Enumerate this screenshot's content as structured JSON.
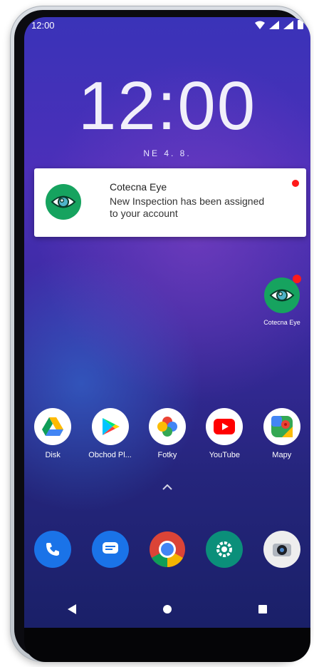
{
  "status_bar": {
    "time": "12:00"
  },
  "lockscreen": {
    "clock": "12:00",
    "date": "NE 4. 8."
  },
  "notification": {
    "app_name": "Cotecna Eye",
    "message_line1": "New Inspection has been assigned",
    "message_line2": "to your account"
  },
  "desktop_app": {
    "label": "Cotecna Eye"
  },
  "apps": [
    {
      "label": "Disk"
    },
    {
      "label": "Obchod Pl..."
    },
    {
      "label": "Fotky"
    },
    {
      "label": "YouTube"
    },
    {
      "label": "Mapy"
    }
  ],
  "dock": [
    {
      "name": "phone"
    },
    {
      "name": "messages"
    },
    {
      "name": "chrome"
    },
    {
      "name": "settings"
    },
    {
      "name": "camera"
    }
  ],
  "colors": {
    "brand_green": "#16a35f",
    "notification_dot": "#ff1a1a",
    "youtube_red": "#ff0000"
  }
}
